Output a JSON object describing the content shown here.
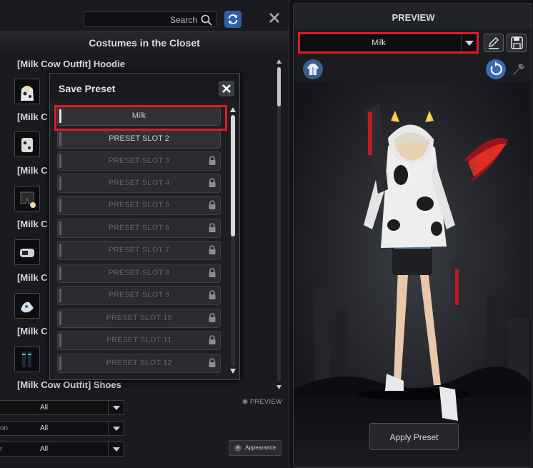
{
  "closet": {
    "search_placeholder": "Search",
    "title": "Costumes in the Closet",
    "items": [
      {
        "label": "[Milk Cow Outfit] Hoodie"
      },
      {
        "label": "[Milk C"
      },
      {
        "label": "[Milk C"
      },
      {
        "label": "[Milk C"
      },
      {
        "label": "[Milk C"
      },
      {
        "label": "[Milk C"
      },
      {
        "label": "[Milk Cow Outfit] Shoes"
      }
    ],
    "preview_toggle_label": "PREVIEW",
    "filters": [
      {
        "label": "",
        "value": "All"
      },
      {
        "label": "on",
        "value": "All"
      },
      {
        "label": "r",
        "value": "All"
      }
    ],
    "appearance_label": "Appearance"
  },
  "save_preset": {
    "title": "Save Preset",
    "slots": [
      {
        "label": "Milk",
        "locked": false,
        "selected": true
      },
      {
        "label": "PRESET SLOT 2",
        "locked": false,
        "selected": false
      },
      {
        "label": "PRESET SLOT 3",
        "locked": true,
        "selected": false
      },
      {
        "label": "PRESET SLOT 4",
        "locked": true,
        "selected": false
      },
      {
        "label": "PRESET SLOT 5",
        "locked": true,
        "selected": false
      },
      {
        "label": "PRESET SLOT 6",
        "locked": true,
        "selected": false
      },
      {
        "label": "PRESET SLOT 7",
        "locked": true,
        "selected": false
      },
      {
        "label": "PRESET SLOT 8",
        "locked": true,
        "selected": false
      },
      {
        "label": "PRESET SLOT 9",
        "locked": true,
        "selected": false
      },
      {
        "label": "PRESET SLOT 10",
        "locked": true,
        "selected": false
      },
      {
        "label": "PRESET SLOT 11",
        "locked": true,
        "selected": false
      },
      {
        "label": "PRESET SLOT 12",
        "locked": true,
        "selected": false
      }
    ]
  },
  "preview": {
    "title": "PREVIEW",
    "selected_preset": "Milk",
    "apply_label": "Apply Preset"
  },
  "icons": {
    "search": "search-icon",
    "refresh": "refresh-icon",
    "close": "close-icon",
    "lock": "lock-icon",
    "pencil": "pencil-icon",
    "save": "save-icon",
    "hoodie": "hoodie-icon",
    "rotate": "rotate-icon",
    "wrench": "wrench-icon",
    "dropdown": "triangle-down-icon"
  },
  "colors": {
    "highlight": "#e01b24",
    "accent_blue": "#3a6cb3",
    "panel_bg": "#1a1b1f"
  }
}
